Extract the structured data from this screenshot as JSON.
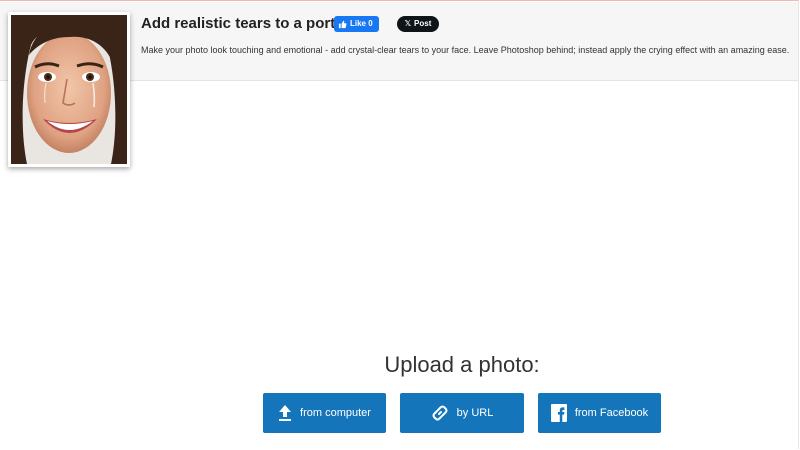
{
  "header": {
    "title": "Add realistic tears to a portrait",
    "description": "Make your photo look touching and emotional - add crystal-clear tears to your face. Leave Photoshop behind; instead apply the crying effect with an amazing ease.",
    "social": {
      "like_label": "Like 0",
      "post_label": "Post",
      "like_color": "#1877f2",
      "post_color": "#0f1419"
    }
  },
  "upload": {
    "heading": "Upload a photo:",
    "button_color": "#1575ba",
    "buttons": [
      {
        "label": "from computer",
        "icon": "upload-arrow-icon"
      },
      {
        "label": "by URL",
        "icon": "link-icon"
      },
      {
        "label": "from Facebook",
        "icon": "facebook-icon"
      }
    ]
  }
}
